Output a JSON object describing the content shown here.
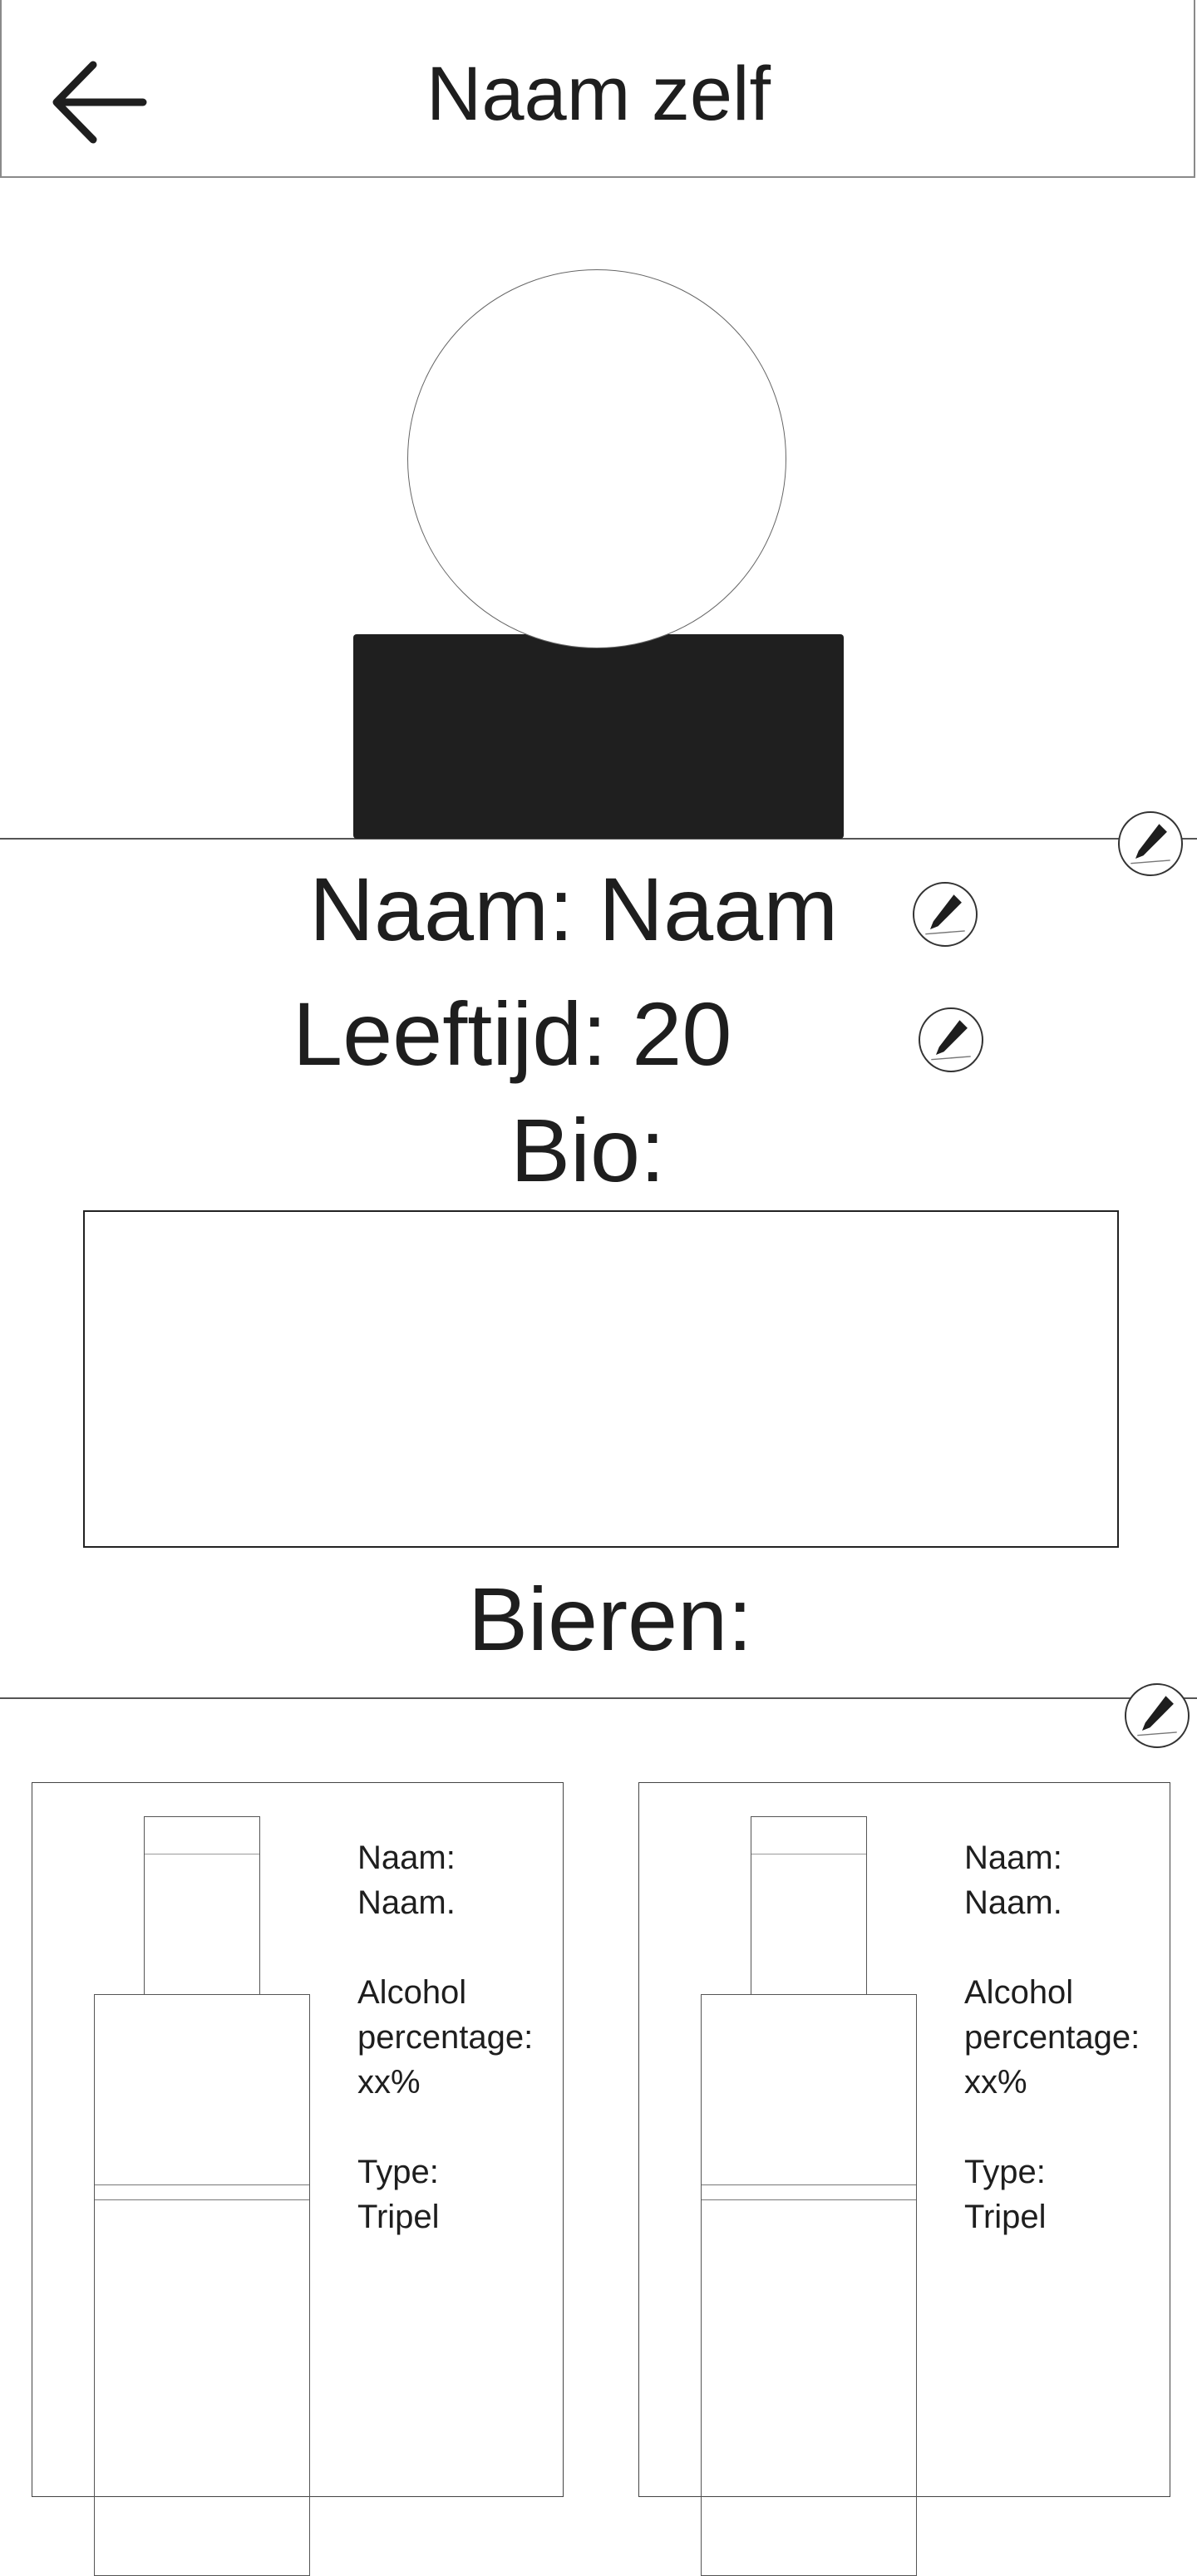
{
  "header": {
    "title": "Naam zelf",
    "back_icon": "arrow-left-icon"
  },
  "avatar": {
    "icon": "user-avatar-placeholder"
  },
  "profile": {
    "name_line": "Naam: Naam",
    "age_line": "Leeftijd: 20",
    "bio_label": "Bio:",
    "bio_text": "",
    "edit_icon": "pencil-icon"
  },
  "beers": {
    "heading": "Bieren:",
    "items": [
      {
        "name_label": "Naam:",
        "name_value": "Naam.",
        "alcohol_label_1": "Alcohol",
        "alcohol_label_2": "percentage:",
        "alcohol_value": "xx%",
        "type_label": "Type:",
        "type_value": "Tripel"
      },
      {
        "name_label": "Naam:",
        "name_value": "Naam.",
        "alcohol_label_1": "Alcohol",
        "alcohol_label_2": "percentage:",
        "alcohol_value": "xx%",
        "type_label": "Type:",
        "type_value": "Tripel"
      }
    ]
  },
  "colors": {
    "ink": "#1e1e1e",
    "background": "#ffffff",
    "avatar_body": "#1f1f1f"
  }
}
